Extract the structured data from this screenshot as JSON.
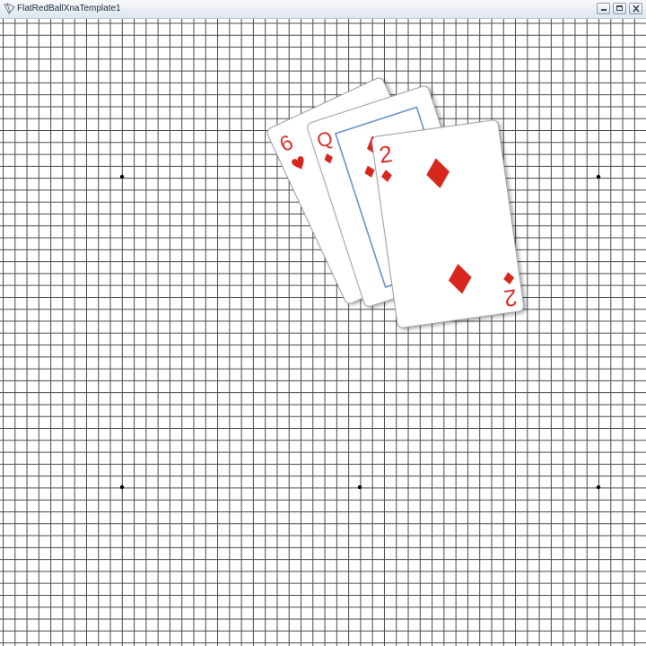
{
  "window": {
    "title": "FlatRedBallXnaTemplate1",
    "icon": "app-window-icon",
    "controls": [
      "minimize-icon",
      "restore-icon",
      "close-icon"
    ]
  },
  "game": {
    "background": "grid",
    "grid_color": "#4a4a4a",
    "marker_color": "#000000",
    "cards": [
      {
        "rank": "6",
        "suit": "hearts",
        "suit_icon": "heart-icon",
        "color": "#d7261e"
      },
      {
        "rank": "Q",
        "suit": "diamonds",
        "suit_icon": "diamond-icon",
        "color": "#d7261e"
      },
      {
        "rank": "2",
        "suit": "diamonds",
        "suit_icon": "diamond-icon",
        "color": "#d7261e"
      }
    ]
  }
}
